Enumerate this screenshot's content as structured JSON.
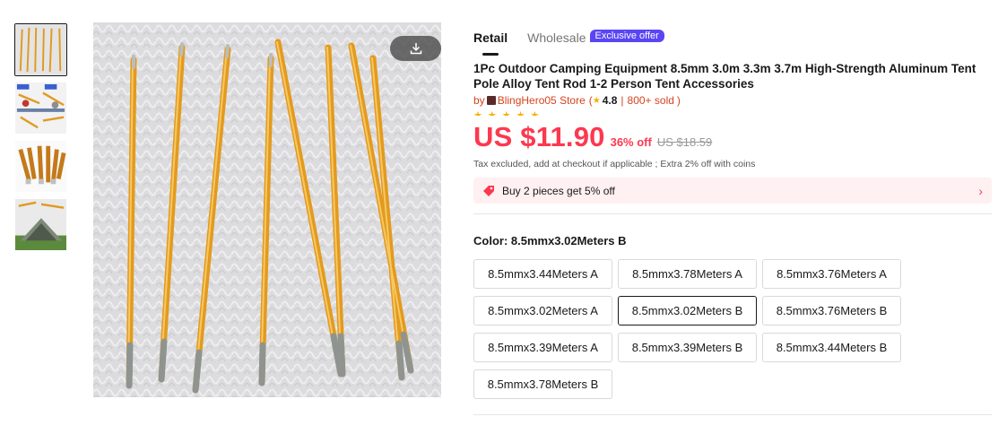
{
  "thumbnails": [
    {
      "name": "thumb-poles",
      "active": true
    },
    {
      "name": "thumb-type-ab",
      "active": false
    },
    {
      "name": "thumb-pole-tips",
      "active": false
    },
    {
      "name": "thumb-tent",
      "active": false
    }
  ],
  "tabs": {
    "retail": "Retail",
    "wholesale": "Wholesale",
    "badge": "Exclusive offer"
  },
  "product": {
    "title": "1Pc Outdoor Camping Equipment 8.5mm 3.0m 3.3m 3.7m High-Strength Aluminum Tent Pole Alloy Tent Rod 1-2 Person Tent Accessories",
    "by": "by",
    "store": "BlingHero05 Store",
    "rating": "4.8",
    "sold": "800+ sold",
    "price": "US $11.90",
    "discount": "36% off",
    "old_price": "US $18.59",
    "tax_note": "Tax excluded, add at checkout if applicable ; Extra 2% off with coins",
    "promo": "Buy 2 pieces get 5% off"
  },
  "color": {
    "label": "Color: 8.5mmx3.02Meters B",
    "options": [
      "8.5mmx3.44Meters A",
      "8.5mmx3.78Meters A",
      "8.5mmx3.76Meters A",
      "8.5mmx3.02Meters A",
      "8.5mmx3.02Meters B",
      "8.5mmx3.76Meters B",
      "8.5mmx3.39Meters A",
      "8.5mmx3.39Meters B",
      "8.5mmx3.44Meters B",
      "8.5mmx3.78Meters B"
    ],
    "selected_index": 4
  },
  "colors": {
    "price_red": "#fd384f",
    "badge_purple": "#5a45f5",
    "pole_orange": "#e8a22a",
    "promo_bg": "#fff0f1"
  }
}
